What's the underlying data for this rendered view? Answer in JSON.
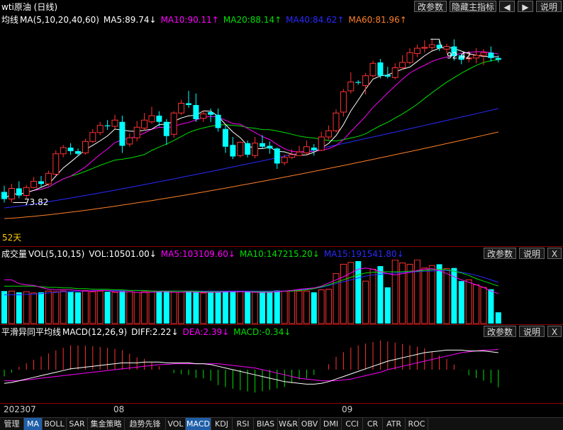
{
  "window": {
    "title": "wti原油 (日线)"
  },
  "toolbar": {
    "change_params": "改参数",
    "hide_indicator": "隐藏主指标",
    "prev": "◀",
    "next": "▶",
    "help": "说明"
  },
  "colors": {
    "bg": "#000000",
    "up": "#ff3232",
    "down": "#00ffff",
    "ma5": "#ffffff",
    "ma10": "#ff00ff",
    "ma20": "#00e000",
    "ma40": "#2a2aff",
    "ma60": "#ff7f27",
    "grid": "#8b0000"
  },
  "main": {
    "legend": {
      "name": "均线",
      "params": "MA(5,10,20,40,60)",
      "ma5": "MA5:89.74↓",
      "ma10": "MA10:90.11↑",
      "ma20": "MA20:88.14↑",
      "ma40": "MA40:84.62↑",
      "ma60": "MA60:81.96↑"
    },
    "high_label": "92.42",
    "low_label": "73.82",
    "days_label": "52天"
  },
  "volume": {
    "legend": {
      "name": "成交量",
      "params": "VOL(5,10,15)",
      "vol": "VOL:10501.00↓",
      "ma5": "MA5:103109.60↓",
      "ma10": "MA10:147215.20↓",
      "ma15": "MA15:191541.80↓"
    },
    "change_params": "改参数",
    "help": "说明",
    "close": "X"
  },
  "macd": {
    "legend": {
      "name": "平滑异同平均线",
      "params": "MACD(12,26,9)",
      "diff": "DIFF:2.22↓",
      "dea": "DEA:2.39↓",
      "macd": "MACD:-0.34↓"
    },
    "change_params": "改参数",
    "help": "说明",
    "close": "X"
  },
  "xaxis": {
    "labels": [
      "202307",
      "08",
      "09"
    ]
  },
  "tabs": [
    "管理",
    "MA",
    "BOLL",
    "SAR",
    "集金策略",
    "趋势先锋",
    "VOL",
    "MACD",
    "KDJ",
    "RSI",
    "BIAS",
    "W&R",
    "OBV",
    "DMI",
    "CCI",
    "CR",
    "ATR",
    "ROC"
  ],
  "active_tabs": [
    "MA",
    "MACD"
  ],
  "chart_data": {
    "type": "candlestick",
    "candles": [
      [
        75.2,
        74.4,
        75.9,
        74.0
      ],
      [
        74.4,
        75.6,
        76.1,
        74.0
      ],
      [
        75.6,
        74.8,
        76.4,
        74.5
      ],
      [
        74.8,
        75.7,
        76.0,
        74.5
      ],
      [
        75.7,
        76.4,
        76.9,
        75.6
      ],
      [
        76.4,
        76.1,
        77.0,
        75.8
      ],
      [
        76.1,
        77.3,
        77.6,
        75.9
      ],
      [
        77.2,
        79.5,
        79.9,
        77.1
      ],
      [
        79.5,
        80.2,
        80.5,
        79.1
      ],
      [
        80.2,
        79.8,
        80.7,
        79.4
      ],
      [
        79.8,
        79.5,
        80.1,
        79.2
      ],
      [
        79.6,
        80.9,
        81.2,
        79.4
      ],
      [
        80.9,
        81.9,
        82.3,
        80.7
      ],
      [
        81.9,
        82.7,
        83.1,
        81.6
      ],
      [
        82.7,
        82.6,
        83.3,
        82.2
      ],
      [
        82.6,
        83.3,
        83.9,
        82.3
      ],
      [
        83.1,
        80.4,
        83.8,
        79.6
      ],
      [
        80.6,
        81.3,
        81.8,
        80.3
      ],
      [
        81.3,
        82.5,
        83.2,
        80.9
      ],
      [
        82.4,
        83.3,
        84.1,
        82.1
      ],
      [
        83.1,
        83.8,
        84.8,
        82.9
      ],
      [
        83.8,
        83.1,
        84.3,
        82.6
      ],
      [
        83.1,
        81.5,
        83.4,
        80.5
      ],
      [
        81.7,
        84.1,
        84.3,
        81.3
      ],
      [
        84.1,
        85.2,
        85.6,
        83.9
      ],
      [
        85.2,
        85.0,
        86.6,
        84.7
      ],
      [
        85.0,
        83.4,
        86.3,
        83.1
      ],
      [
        83.5,
        84.0,
        84.4,
        83.1
      ],
      [
        84.2,
        83.9,
        84.6,
        83.1
      ],
      [
        83.9,
        82.4,
        84.6,
        82.0
      ],
      [
        82.3,
        80.3,
        82.7,
        79.6
      ],
      [
        80.5,
        79.2,
        81.4,
        78.9
      ],
      [
        79.3,
        80.8,
        80.9,
        79.1
      ],
      [
        80.7,
        79.4,
        81.0,
        79.1
      ],
      [
        79.3,
        80.7,
        81.4,
        79.0
      ],
      [
        80.7,
        80.3,
        81.6,
        80.1
      ],
      [
        80.4,
        80.1,
        80.9,
        79.5
      ],
      [
        80.1,
        78.4,
        80.2,
        77.8
      ],
      [
        78.5,
        79.1,
        79.4,
        78.2
      ],
      [
        79.1,
        79.4,
        80.0,
        78.9
      ],
      [
        79.3,
        79.7,
        80.4,
        79.3
      ],
      [
        79.6,
        80.3,
        81.0,
        79.4
      ],
      [
        80.2,
        79.9,
        80.6,
        79.3
      ],
      [
        79.9,
        81.4,
        82.0,
        79.8
      ],
      [
        81.4,
        82.1,
        82.7,
        81.1
      ],
      [
        82.1,
        84.1,
        84.5,
        81.9
      ],
      [
        84.2,
        86.5,
        86.8,
        83.7
      ],
      [
        86.6,
        87.6,
        88.7,
        86.3
      ],
      [
        87.6,
        87.5,
        87.8,
        87.3
      ],
      [
        87.2,
        88.3,
        88.6,
        86.2
      ],
      [
        88.3,
        89.7,
        90.0,
        88.1
      ],
      [
        89.8,
        88.3,
        90.2,
        88.0
      ],
      [
        88.4,
        88.2,
        89.3,
        88.0
      ],
      [
        88.1,
        89.2,
        89.7,
        87.9
      ],
      [
        89.2,
        89.8,
        90.6,
        89.0
      ],
      [
        89.8,
        90.9,
        91.4,
        89.6
      ],
      [
        90.8,
        91.4,
        91.8,
        90.4
      ],
      [
        91.4,
        91.5,
        92.3,
        90.9
      ],
      [
        91.5,
        91.8,
        92.5,
        91.1
      ],
      [
        91.8,
        91.4,
        92.4,
        91.1
      ],
      [
        91.3,
        91.6,
        91.9,
        90.8
      ],
      [
        91.6,
        90.5,
        92.4,
        90.0
      ],
      [
        90.6,
        90.1,
        90.8,
        89.6
      ],
      [
        90.2,
        90.3,
        91.1,
        89.8
      ],
      [
        90.3,
        90.6,
        91.4,
        89.7
      ],
      [
        90.6,
        90.9,
        91.3,
        89.5
      ],
      [
        90.9,
        90.3,
        91.6,
        89.9
      ],
      [
        90.3,
        90.1,
        90.6,
        89.8
      ]
    ],
    "price_high": 92.42,
    "price_low": 73.82,
    "volume": [
      52,
      52,
      50,
      51,
      49,
      50,
      52,
      51,
      52,
      51,
      50,
      53,
      51,
      52,
      51,
      50,
      52,
      51,
      50,
      51,
      52,
      51,
      52,
      50,
      50,
      52,
      51,
      49,
      51,
      50,
      52,
      51,
      51,
      52,
      50,
      51,
      50,
      53,
      52,
      53,
      52,
      52,
      50,
      54,
      55,
      80,
      95,
      98,
      100,
      68,
      87,
      92,
      58,
      102,
      97,
      95,
      102,
      89,
      93,
      95,
      88,
      89,
      68,
      70,
      62,
      58,
      55,
      18
    ],
    "volume_ma5": [
      70,
      70,
      64,
      62,
      61,
      58,
      55,
      54,
      54,
      54,
      53,
      52,
      52,
      53,
      53,
      51,
      51,
      51,
      50,
      50,
      50,
      51,
      51,
      50,
      50,
      51,
      50,
      50,
      50,
      50,
      51,
      51,
      51,
      51,
      50,
      50,
      50,
      51,
      52,
      53,
      55,
      56,
      57,
      60,
      65,
      70,
      75,
      81,
      87,
      89,
      87,
      83,
      80,
      78,
      80,
      82,
      85,
      87,
      88,
      85,
      80,
      75,
      70,
      66,
      62,
      58,
      52,
      48
    ],
    "volume_ma10": [
      60,
      60,
      60,
      60,
      60,
      59,
      58,
      58,
      57,
      57,
      56,
      56,
      55,
      55,
      55,
      54,
      54,
      53,
      53,
      53,
      52,
      52,
      52,
      52,
      52,
      52,
      52,
      51,
      51,
      51,
      51,
      51,
      51,
      51,
      51,
      51,
      51,
      51,
      52,
      52,
      53,
      54,
      56,
      59,
      62,
      66,
      70,
      74,
      78,
      81,
      82,
      83,
      83,
      83,
      83,
      84,
      84,
      85,
      86,
      87,
      86,
      84,
      81,
      77,
      72,
      68,
      64,
      60
    ],
    "volume_ma15": [
      46,
      46,
      46,
      47,
      47,
      48,
      49,
      50,
      51,
      51,
      52,
      52,
      53,
      53,
      53,
      53,
      53,
      53,
      53,
      53,
      52,
      52,
      52,
      52,
      52,
      52,
      52,
      52,
      52,
      52,
      52,
      52,
      52,
      52,
      52,
      52,
      52,
      52,
      52,
      53,
      54,
      55,
      56,
      58,
      61,
      64,
      67,
      70,
      73,
      76,
      78,
      79,
      80,
      81,
      82,
      82,
      83,
      84,
      84,
      85,
      85,
      84,
      82,
      80,
      77,
      74,
      70,
      66
    ],
    "macd_diff": [
      -1.6,
      -1.5,
      -1.3,
      -1.1,
      -0.9,
      -0.7,
      -0.5,
      -0.3,
      -0.1,
      0.1,
      0.2,
      0.3,
      0.4,
      0.5,
      0.6,
      0.7,
      0.8,
      0.8,
      0.8,
      0.9,
      0.9,
      0.9,
      0.8,
      0.8,
      0.8,
      0.8,
      0.7,
      0.7,
      0.6,
      0.4,
      0.2,
      0.0,
      -0.2,
      -0.4,
      -0.6,
      -0.8,
      -1.0,
      -1.2,
      -1.4,
      -1.5,
      -1.6,
      -1.7,
      -1.7,
      -1.6,
      -1.4,
      -1.1,
      -0.8,
      -0.5,
      -0.2,
      0.1,
      0.4,
      0.7,
      1.0,
      1.2,
      1.4,
      1.6,
      1.8,
      2.0,
      2.1,
      2.2,
      2.3,
      2.3,
      2.3,
      2.2,
      2.2,
      2.2,
      2.1,
      2.0
    ],
    "macd_dea": [
      -1.3,
      -1.3,
      -1.3,
      -1.2,
      -1.1,
      -1.0,
      -0.9,
      -0.8,
      -0.7,
      -0.6,
      -0.5,
      -0.4,
      -0.3,
      -0.2,
      -0.1,
      0.0,
      0.1,
      0.2,
      0.3,
      0.4,
      0.5,
      0.6,
      0.6,
      0.7,
      0.7,
      0.7,
      0.7,
      0.7,
      0.7,
      0.7,
      0.6,
      0.5,
      0.4,
      0.3,
      0.2,
      0.0,
      -0.2,
      -0.4,
      -0.6,
      -0.8,
      -1.0,
      -1.1,
      -1.2,
      -1.3,
      -1.3,
      -1.3,
      -1.2,
      -1.1,
      -0.9,
      -0.7,
      -0.5,
      -0.3,
      0.0,
      0.2,
      0.4,
      0.6,
      0.8,
      1.0,
      1.2,
      1.4,
      1.6,
      1.8,
      2.0,
      2.1,
      2.2,
      2.3,
      2.3,
      2.4
    ],
    "x_labels": [
      "202307",
      "08",
      "09"
    ]
  }
}
